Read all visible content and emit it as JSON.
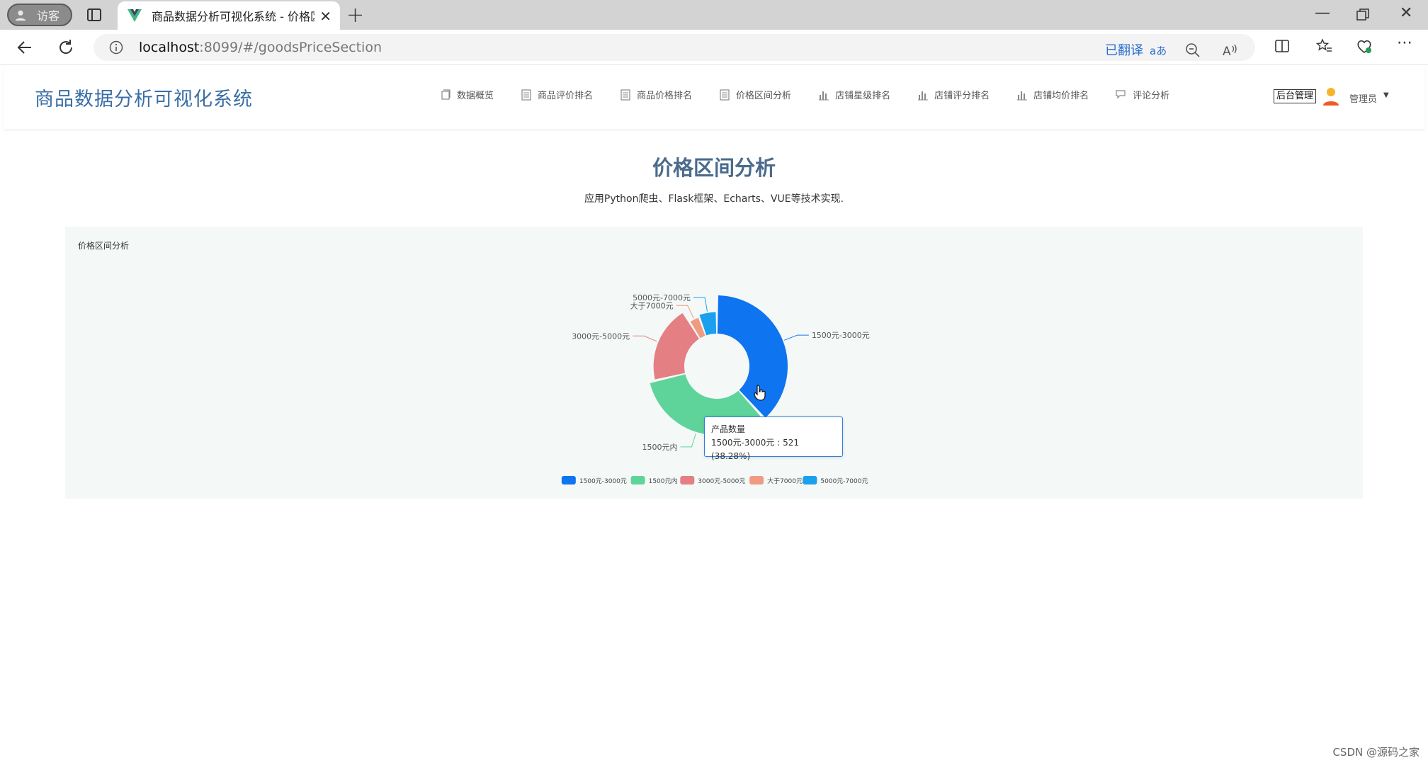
{
  "browser": {
    "guest_label": "访客",
    "tab_title": "商品数据分析可视化系统 - 价格区",
    "url_host": "localhost",
    "url_rest": ":8099/#/goodsPriceSection",
    "translated_label": "已翻译"
  },
  "app": {
    "title": "商品数据分析可视化系统",
    "menu": [
      {
        "label": "数据概览",
        "icon": "copy-icon"
      },
      {
        "label": "商品评价排名",
        "icon": "list-icon"
      },
      {
        "label": "商品价格排名",
        "icon": "list-icon"
      },
      {
        "label": "价格区间分析",
        "icon": "list-icon"
      },
      {
        "label": "店铺星级排名",
        "icon": "bar-chart-icon"
      },
      {
        "label": "店铺评分排名",
        "icon": "bar-chart-icon"
      },
      {
        "label": "店铺均价排名",
        "icon": "bar-chart-icon"
      },
      {
        "label": "评论分析",
        "icon": "comment-icon"
      }
    ],
    "admin_label": "后台管理",
    "user_label": "管理员"
  },
  "page": {
    "title": "价格区间分析",
    "subtitle": "应用Python爬虫、Flask框架、Echarts、VUE等技术实现."
  },
  "chart_data": {
    "type": "pie",
    "variant": "rose-donut",
    "title": "价格区间分析",
    "series_name": "产品数量",
    "categories": [
      "1500元-3000元",
      "1500元内",
      "3000元-5000元",
      "大于7000元",
      "5000元-7000元"
    ],
    "values": [
      521,
      450,
      270,
      45,
      75
    ],
    "colors": [
      "#0f74f0",
      "#5fd49a",
      "#e47f84",
      "#ef9b82",
      "#1aa0ef"
    ],
    "legend": "bottom"
  },
  "tooltip": {
    "title": "产品数量",
    "text": "1500元-3000元 : 521 (38.28%)"
  },
  "watermark": "CSDN @源码之家"
}
